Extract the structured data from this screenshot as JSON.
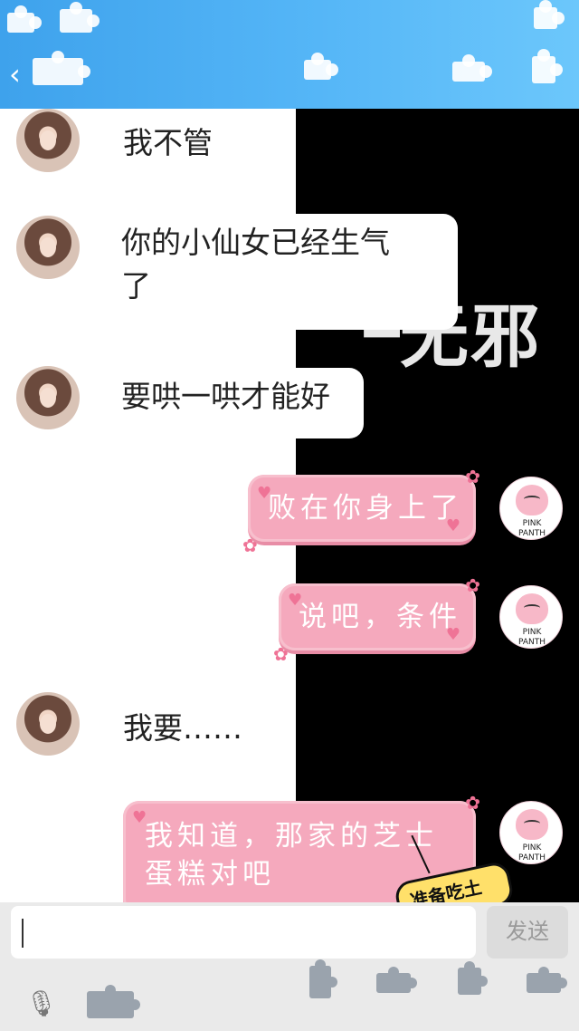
{
  "header": {
    "back_icon": "back-arrow-icon"
  },
  "wallpaper": {
    "text": "无邪"
  },
  "messages": [
    {
      "side": "left",
      "text": "我不管",
      "style": "plain"
    },
    {
      "side": "left",
      "text": "你的小仙女已经生气了",
      "line1": "你的小仙女已经生气",
      "line2": "了",
      "style": "bubble"
    },
    {
      "side": "left",
      "text": "要哄一哄才能好",
      "style": "bubble"
    },
    {
      "side": "right",
      "text": "败在你身上了",
      "style": "pink"
    },
    {
      "side": "right",
      "text": "说吧，条件",
      "style": "pink"
    },
    {
      "side": "left",
      "text": "我要……",
      "style": "plain"
    },
    {
      "side": "right",
      "text": "我知道，那家的芝士蛋糕对吧",
      "line1": "我知道，那家的芝士",
      "line2": "蛋糕对吧",
      "style": "pink"
    }
  ],
  "avatars": {
    "panther_label_1": "PINK",
    "panther_label_2": "PANTH"
  },
  "sticker": {
    "text": "准备吃土"
  },
  "composer": {
    "input_value": "",
    "send_label": "发送",
    "mic_icon": "microphone-icon"
  },
  "colors": {
    "header": "#4aaef2",
    "pink_bubble": "#f5a9bd",
    "wallpaper": "#000000"
  }
}
